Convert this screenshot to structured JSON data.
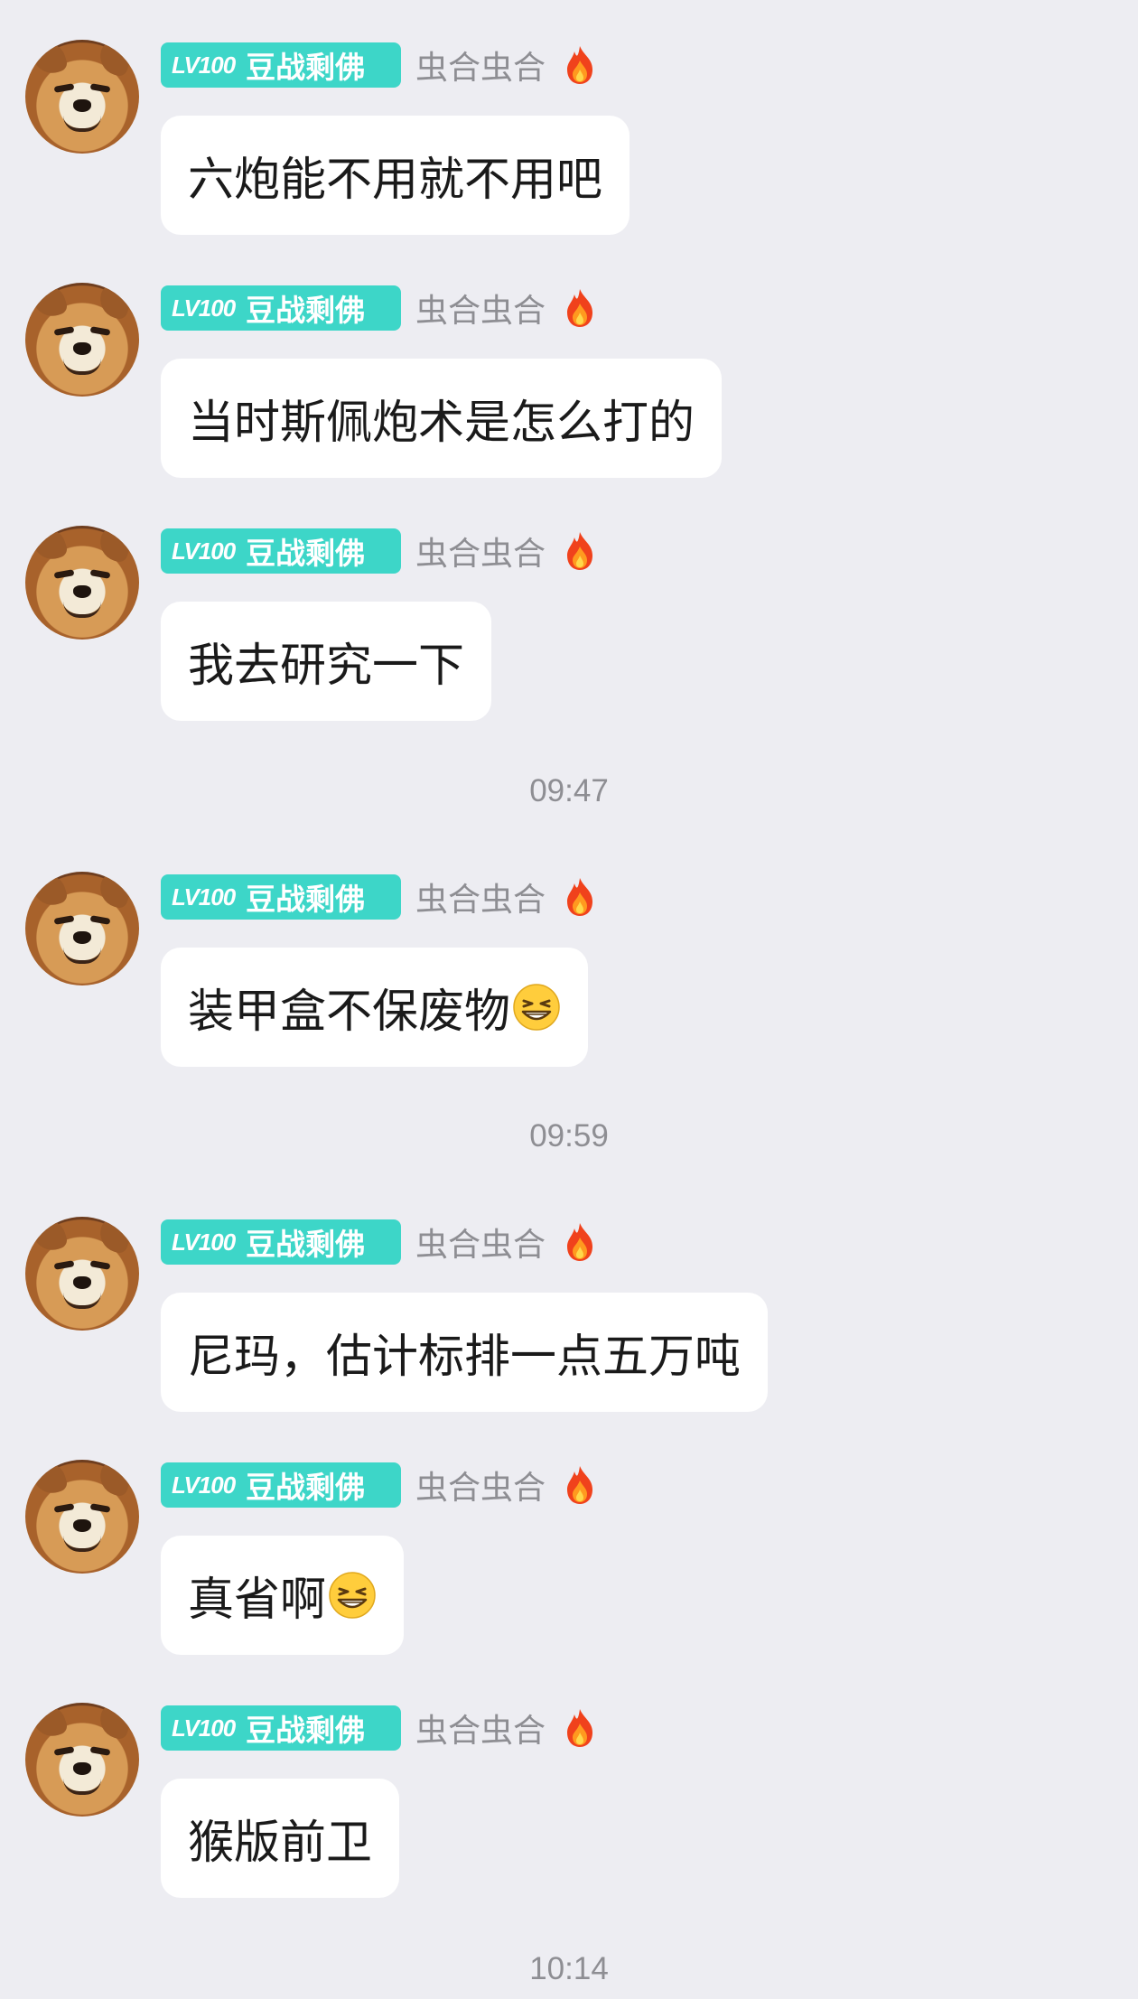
{
  "messages": [
    {
      "level": "LV100",
      "title": "豆战剩佛",
      "nickname": "虫合虫合",
      "text": "六炮能不用就不用吧",
      "emoji": null
    },
    {
      "level": "LV100",
      "title": "豆战剩佛",
      "nickname": "虫合虫合",
      "text": "当时斯佩炮术是怎么打的",
      "emoji": null
    },
    {
      "level": "LV100",
      "title": "豆战剩佛",
      "nickname": "虫合虫合",
      "text": "我去研究一下",
      "emoji": null
    },
    {
      "level": "LV100",
      "title": "豆战剩佛",
      "nickname": "虫合虫合",
      "text": "装甲盒不保废物",
      "emoji": "grin-emoji"
    },
    {
      "level": "LV100",
      "title": "豆战剩佛",
      "nickname": "虫合虫合",
      "text": "尼玛，估计标排一点五万吨",
      "emoji": null
    },
    {
      "level": "LV100",
      "title": "豆战剩佛",
      "nickname": "虫合虫合",
      "text": "真省啊",
      "emoji": "grin-emoji"
    },
    {
      "level": "LV100",
      "title": "豆战剩佛",
      "nickname": "虫合虫合",
      "text": "猴版前卫",
      "emoji": null
    }
  ],
  "timestamps": [
    "09:47",
    "09:59",
    "10:14"
  ],
  "colors": {
    "background": "#ededf2",
    "bubble": "#ffffff",
    "badge": "#3dd6c8",
    "nickname": "#8e8e93",
    "timestamp": "#8e8e93"
  },
  "icons": {
    "fire": "fire-icon",
    "avatar": "shiba-doge-avatar",
    "emoji": "grin-emoji-icon"
  }
}
